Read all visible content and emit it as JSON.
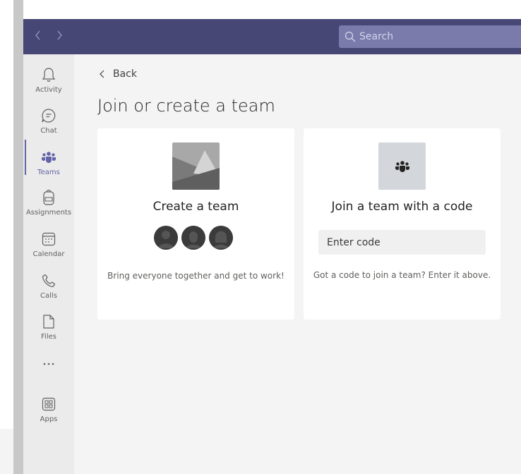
{
  "titlebar": {
    "back_arrow": "chevron-left-icon",
    "forward_arrow": "chevron-right-icon",
    "search_placeholder": "Search",
    "color": "#464775"
  },
  "rail": {
    "items": [
      {
        "label": "Activity",
        "icon": "bell-icon"
      },
      {
        "label": "Chat",
        "icon": "chat-icon"
      },
      {
        "label": "Teams",
        "icon": "teams-icon",
        "active": true
      },
      {
        "label": "Assignments",
        "icon": "backpack-icon"
      },
      {
        "label": "Calendar",
        "icon": "calendar-icon"
      },
      {
        "label": "Calls",
        "icon": "phone-icon"
      },
      {
        "label": "Files",
        "icon": "file-icon"
      },
      {
        "label": "Apps",
        "icon": "apps-icon"
      }
    ],
    "more_icon": "more-dots-icon",
    "accent": "#6264a7"
  },
  "main": {
    "back_label": "Back",
    "title": "Join or create a team",
    "create_card": {
      "title": "Create a team",
      "description": "Bring everyone together and get to work!"
    },
    "join_card": {
      "title": "Join a team with a code",
      "input_placeholder": "Enter code",
      "description": "Got a code to join a team? Enter it above."
    }
  }
}
